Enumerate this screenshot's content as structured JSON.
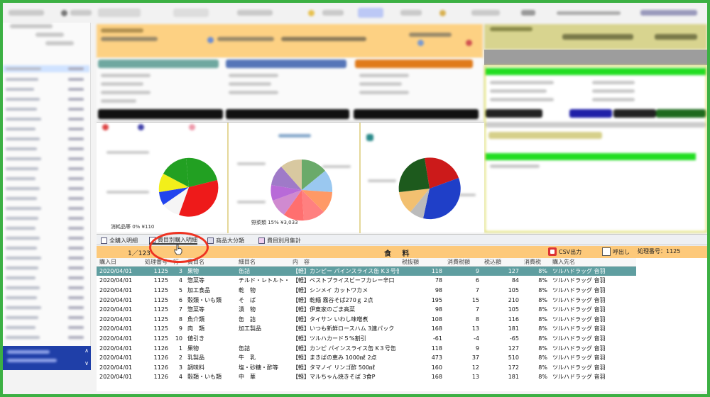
{
  "tabs": [
    {
      "label": "全購入明細",
      "active": false
    },
    {
      "label": "費目別購入明細",
      "active": true
    },
    {
      "label": "商品大分類",
      "active": false
    },
    {
      "label": "費目別月集計",
      "active": false
    }
  ],
  "header": {
    "pager": "1／123",
    "category": "食 料",
    "csv_label": "CSV出力",
    "call_label": "呼出し",
    "process_label": "処理番号：1125"
  },
  "chart_labels": {
    "pie1": "消耗品等 0% ¥110",
    "pie2": "野菜類 15% ¥3,033"
  },
  "columns": [
    "購入日",
    "処理番号",
    "行",
    "費目名",
    "細目名",
    "内　容",
    "税抜額",
    "消費税額",
    "税込額",
    "消費税",
    "購入先名"
  ],
  "rows": [
    [
      "2020/04/01",
      "1125",
      "3",
      "果物",
      "缶詰",
      "【軽】カンピー パインスライス缶 K３号缶",
      "118",
      "9",
      "127",
      "8%",
      "ツルハドラッグ 音羽"
    ],
    [
      "2020/04/01",
      "1125",
      "4",
      "惣菜等",
      "チルド・レトルト・パウチ",
      "【軽】ベストプライスビーフカレー辛口",
      "78",
      "6",
      "84",
      "8%",
      "ツルハドラッグ 音羽"
    ],
    [
      "2020/04/01",
      "1125",
      "5",
      "加工食品",
      "乾　物",
      "【軽】シンメイ カットワカメ",
      "98",
      "7",
      "105",
      "8%",
      "ツルハドラッグ 音羽"
    ],
    [
      "2020/04/01",
      "1125",
      "6",
      "穀類・いも類",
      "そ　ば",
      "【軽】乾麺 霧谷そば270ｇ 2点",
      "195",
      "15",
      "210",
      "8%",
      "ツルハドラッグ 音羽"
    ],
    [
      "2020/04/01",
      "1125",
      "7",
      "惣菜等",
      "漬　物",
      "【軽】伊東家のごま高菜",
      "98",
      "7",
      "105",
      "8%",
      "ツルハドラッグ 音羽"
    ],
    [
      "2020/04/01",
      "1125",
      "8",
      "魚介類",
      "缶　詰",
      "【軽】タイサン いわし味噌煮",
      "108",
      "8",
      "116",
      "8%",
      "ツルハドラッグ 音羽"
    ],
    [
      "2020/04/01",
      "1125",
      "9",
      "肉　類",
      "加工製品",
      "【軽】いつも新鮮ロースハム 3連パック",
      "168",
      "13",
      "181",
      "8%",
      "ツルハドラッグ 音羽"
    ],
    [
      "2020/04/01",
      "1125",
      "10",
      "値引き",
      "",
      "【軽】ツルハカード５%割引",
      "-61",
      "-4",
      "-65",
      "8%",
      "ツルハドラッグ 音羽"
    ],
    [
      "2020/04/01",
      "1126",
      "1",
      "果物",
      "缶詰",
      "【軽】カンピ パインスライス缶 K３号缶",
      "118",
      "9",
      "127",
      "8%",
      "ツルハドラッグ 音羽"
    ],
    [
      "2020/04/01",
      "1126",
      "2",
      "乳製品",
      "牛　乳",
      "【軽】まきばの恵み 1000㎖ 2点",
      "473",
      "37",
      "510",
      "8%",
      "ツルハドラッグ 音羽"
    ],
    [
      "2020/04/01",
      "1126",
      "3",
      "調味料",
      "塩・砂糖・酢等",
      "【軽】タマノイ リンゴ酢 500㎖",
      "160",
      "12",
      "172",
      "8%",
      "ツルハドラッグ 音羽"
    ],
    [
      "2020/04/01",
      "1126",
      "4",
      "穀類・いも類",
      "中　華",
      "【軽】マルちゃん焼きそば 3食P",
      "168",
      "13",
      "181",
      "8%",
      "ツルハドラッグ 音羽"
    ]
  ],
  "selected_row": 0,
  "colors": {
    "border": "#3cb043",
    "header_bar": "#fdc97a",
    "selected_row": "#5f9ea0",
    "highlight": "#ee3322",
    "sidebar_bottom": "#1f3fa8"
  },
  "icons": [
    "table-icon",
    "list-icon",
    "chart-icon",
    "csv-export-icon",
    "call-icon",
    "hand-cursor-icon"
  ]
}
